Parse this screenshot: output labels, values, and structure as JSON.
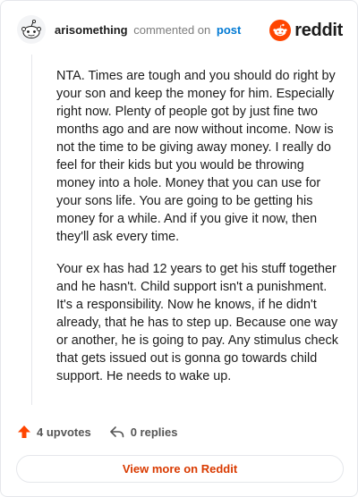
{
  "header": {
    "username": "arisomething",
    "action_text": "commented on",
    "post_link": "post",
    "brand_name": "reddit",
    "brand_color": "#ff4500"
  },
  "comment": {
    "paragraphs": [
      "NTA. Times are tough and you should do right by your son and keep the money for him. Especially right now. Plenty of people got by just fine two months ago and are now without income. Now is not the time to be giving away money. I really do feel for their kids but you would be throwing money into a hole. Money that you can use for your sons life. You are going to be getting his money for a while. And if you give it now, then they'll ask every time.",
      "Your ex has had 12 years to get his stuff together and he hasn't. Child support isn't a punishment. It's a responsibility. Now he knows, if he didn't already, that he has to step up. Because one way or another, he is going to pay. Any stimulus check that gets issued out is gonna go towards child support. He needs to wake up."
    ]
  },
  "actions": {
    "upvotes_label": "4 upvotes",
    "replies_label": "0 replies",
    "upvote_color": "#ff4500"
  },
  "footer": {
    "view_more_label": "View more on Reddit",
    "view_more_color": "#d93a00"
  }
}
